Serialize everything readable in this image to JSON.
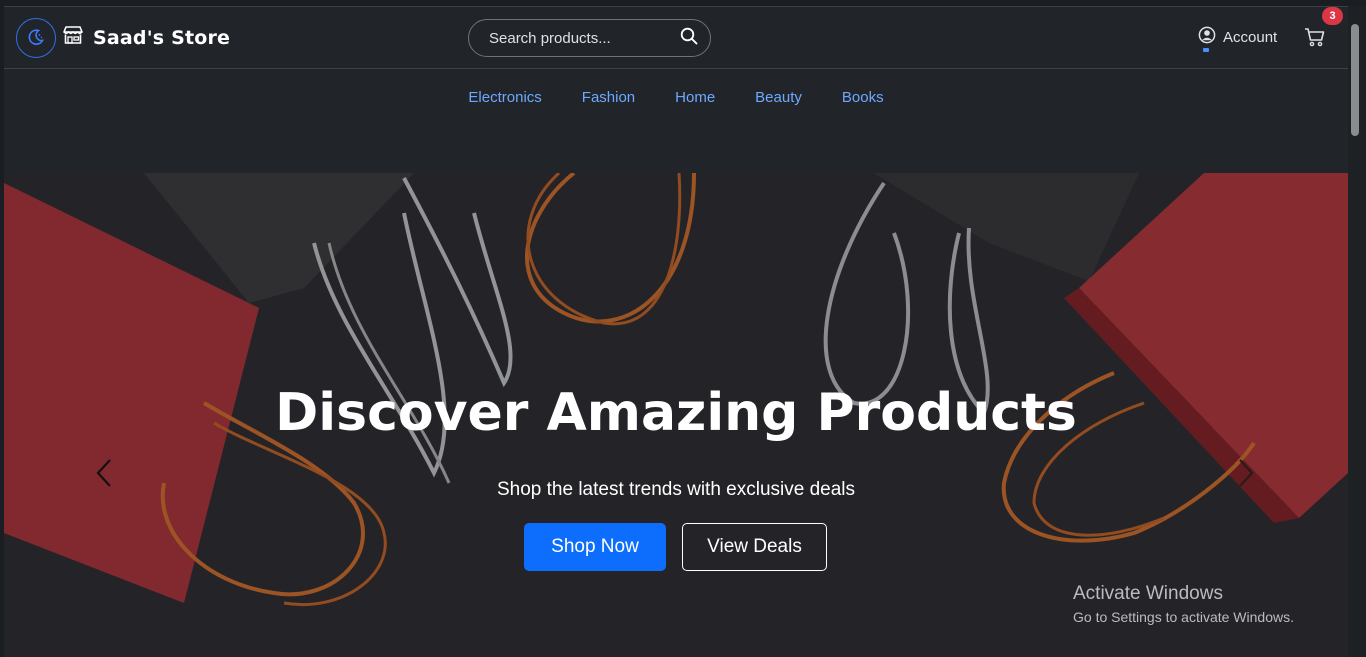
{
  "header": {
    "brand_name": "Saad's Store",
    "search_placeholder": "Search products...",
    "account_label": "Account",
    "cart_count": "3"
  },
  "categories": [
    "Electronics",
    "Fashion",
    "Home",
    "Beauty",
    "Books"
  ],
  "hero": {
    "title": "Discover Amazing Products",
    "subtitle": "Shop the latest trends with exclusive deals",
    "primary_button": "Shop Now",
    "secondary_button": "View Deals"
  },
  "watermark": {
    "title": "Activate Windows",
    "subtitle": "Go to Settings to activate Windows."
  },
  "colors": {
    "accent": "#0d6efd",
    "link": "#6ea8fe",
    "badge": "#dc3545",
    "background": "#212529"
  },
  "icons": [
    "moon-icon",
    "store-icon",
    "search-icon",
    "user-circle-icon",
    "cart-icon",
    "chevron-left-icon",
    "chevron-right-icon"
  ]
}
